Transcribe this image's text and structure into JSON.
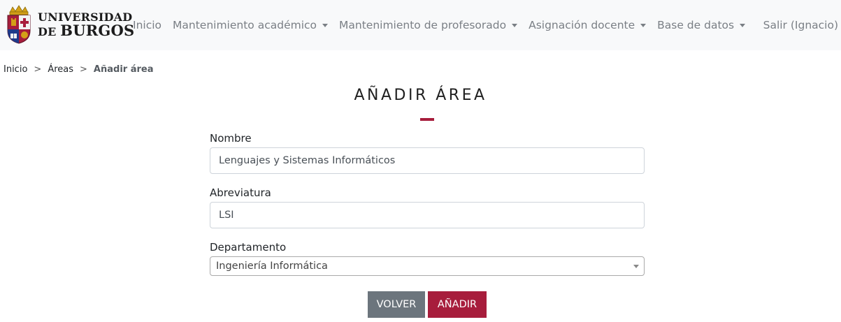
{
  "brand": {
    "line1": "UNIVERSIDAD",
    "line2_prefix": "DE ",
    "line2_main": "BURGOS",
    "colors": {
      "shield_red": "#a71d3c",
      "shield_blue": "#1e3a8a",
      "gold": "#d4a017"
    }
  },
  "nav": {
    "items": [
      {
        "label": "Inicio",
        "dropdown": false
      },
      {
        "label": "Mantenimiento académico",
        "dropdown": true
      },
      {
        "label": "Mantenimiento de profesorado",
        "dropdown": true
      },
      {
        "label": "Asignación docente",
        "dropdown": true
      },
      {
        "label": "Base de datos",
        "dropdown": true
      }
    ],
    "logout_label": "Salir (Ignacio)"
  },
  "breadcrumb": {
    "items": [
      "Inicio",
      "Áreas"
    ],
    "current": "Añadir área",
    "separator": ">"
  },
  "page": {
    "title": "AÑADIR ÁREA",
    "accent_color": "#a71d3c"
  },
  "form": {
    "nombre": {
      "label": "Nombre",
      "value": "Lenguajes y Sistemas Informáticos"
    },
    "abreviatura": {
      "label": "Abreviatura",
      "value": "LSI"
    },
    "departamento": {
      "label": "Departamento",
      "selected": "Ingeniería Informática"
    }
  },
  "buttons": {
    "back_label": "VOLVER",
    "add_label": "AÑADIR"
  }
}
